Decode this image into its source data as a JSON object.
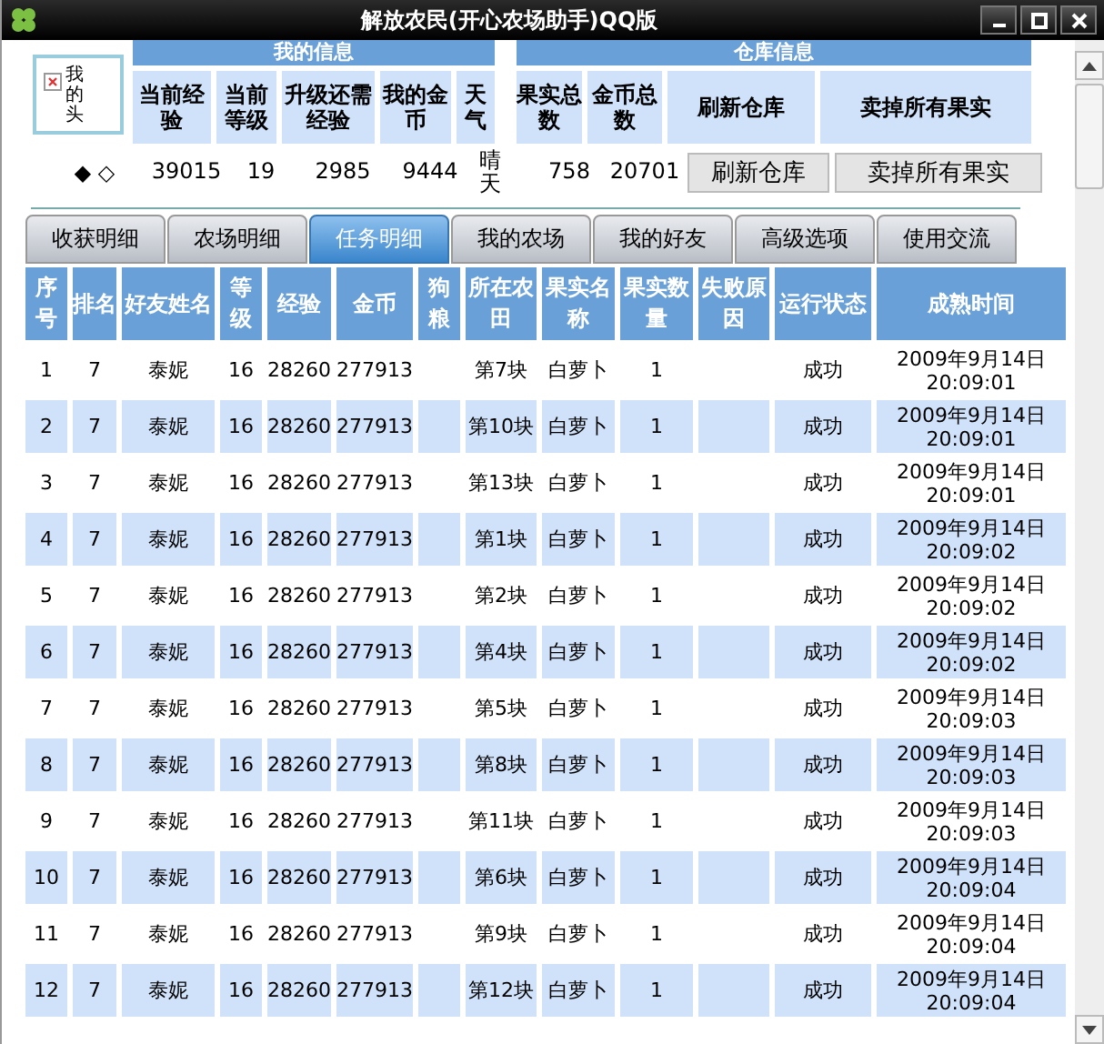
{
  "window": {
    "title": "解放农民(开心农场助手)QQ版"
  },
  "my_info": {
    "heading": "我的信息",
    "avatar_alt": "我的头",
    "columns": [
      "当前经验",
      "当前等级",
      "升级还需经验",
      "我的金币",
      "天气"
    ],
    "marks": "◆ ◇",
    "values": [
      "39015",
      "19",
      "2985",
      "9444",
      "晴天"
    ]
  },
  "warehouse": {
    "heading": "仓库信息",
    "columns": [
      "果实总数",
      "金币总数",
      "刷新仓库",
      "卖掉所有果实"
    ],
    "values": [
      "758",
      "20701"
    ],
    "buttons": [
      "刷新仓库",
      "卖掉所有果实"
    ]
  },
  "tabs": [
    {
      "label": "收获明细",
      "selected": false
    },
    {
      "label": "农场明细",
      "selected": false
    },
    {
      "label": "任务明细",
      "selected": true
    },
    {
      "label": "我的农场",
      "selected": false
    },
    {
      "label": "我的好友",
      "selected": false
    },
    {
      "label": "高级选项",
      "selected": false
    },
    {
      "label": "使用交流",
      "selected": false
    }
  ],
  "table": {
    "columns": [
      "序号",
      "排名",
      "好友姓名",
      "等级",
      "经验",
      "金币",
      "狗粮",
      "所在农田",
      "果实名称",
      "果实数量",
      "失败原因",
      "运行状态",
      "成熟时间"
    ],
    "rows": [
      {
        "no": "1",
        "rank": "7",
        "name": "泰妮",
        "level": "16",
        "exp": "28260",
        "gold": "277913",
        "field": "第7块",
        "fruit": "白萝卜",
        "qty": "1",
        "status": "成功",
        "time": "2009年9月14日 20:09:01"
      },
      {
        "no": "2",
        "rank": "7",
        "name": "泰妮",
        "level": "16",
        "exp": "28260",
        "gold": "277913",
        "field": "第10块",
        "fruit": "白萝卜",
        "qty": "1",
        "status": "成功",
        "time": "2009年9月14日 20:09:01"
      },
      {
        "no": "3",
        "rank": "7",
        "name": "泰妮",
        "level": "16",
        "exp": "28260",
        "gold": "277913",
        "field": "第13块",
        "fruit": "白萝卜",
        "qty": "1",
        "status": "成功",
        "time": "2009年9月14日 20:09:01"
      },
      {
        "no": "4",
        "rank": "7",
        "name": "泰妮",
        "level": "16",
        "exp": "28260",
        "gold": "277913",
        "field": "第1块",
        "fruit": "白萝卜",
        "qty": "1",
        "status": "成功",
        "time": "2009年9月14日 20:09:02"
      },
      {
        "no": "5",
        "rank": "7",
        "name": "泰妮",
        "level": "16",
        "exp": "28260",
        "gold": "277913",
        "field": "第2块",
        "fruit": "白萝卜",
        "qty": "1",
        "status": "成功",
        "time": "2009年9月14日 20:09:02"
      },
      {
        "no": "6",
        "rank": "7",
        "name": "泰妮",
        "level": "16",
        "exp": "28260",
        "gold": "277913",
        "field": "第4块",
        "fruit": "白萝卜",
        "qty": "1",
        "status": "成功",
        "time": "2009年9月14日 20:09:02"
      },
      {
        "no": "7",
        "rank": "7",
        "name": "泰妮",
        "level": "16",
        "exp": "28260",
        "gold": "277913",
        "field": "第5块",
        "fruit": "白萝卜",
        "qty": "1",
        "status": "成功",
        "time": "2009年9月14日 20:09:03"
      },
      {
        "no": "8",
        "rank": "7",
        "name": "泰妮",
        "level": "16",
        "exp": "28260",
        "gold": "277913",
        "field": "第8块",
        "fruit": "白萝卜",
        "qty": "1",
        "status": "成功",
        "time": "2009年9月14日 20:09:03"
      },
      {
        "no": "9",
        "rank": "7",
        "name": "泰妮",
        "level": "16",
        "exp": "28260",
        "gold": "277913",
        "field": "第11块",
        "fruit": "白萝卜",
        "qty": "1",
        "status": "成功",
        "time": "2009年9月14日 20:09:03"
      },
      {
        "no": "10",
        "rank": "7",
        "name": "泰妮",
        "level": "16",
        "exp": "28260",
        "gold": "277913",
        "field": "第6块",
        "fruit": "白萝卜",
        "qty": "1",
        "status": "成功",
        "time": "2009年9月14日 20:09:04"
      },
      {
        "no": "11",
        "rank": "7",
        "name": "泰妮",
        "level": "16",
        "exp": "28260",
        "gold": "277913",
        "field": "第9块",
        "fruit": "白萝卜",
        "qty": "1",
        "status": "成功",
        "time": "2009年9月14日 20:09:04"
      },
      {
        "no": "12",
        "rank": "7",
        "name": "泰妮",
        "level": "16",
        "exp": "28260",
        "gold": "277913",
        "field": "第12块",
        "fruit": "白萝卜",
        "qty": "1",
        "status": "成功",
        "time": "2009年9月14日 20:09:04"
      }
    ]
  }
}
